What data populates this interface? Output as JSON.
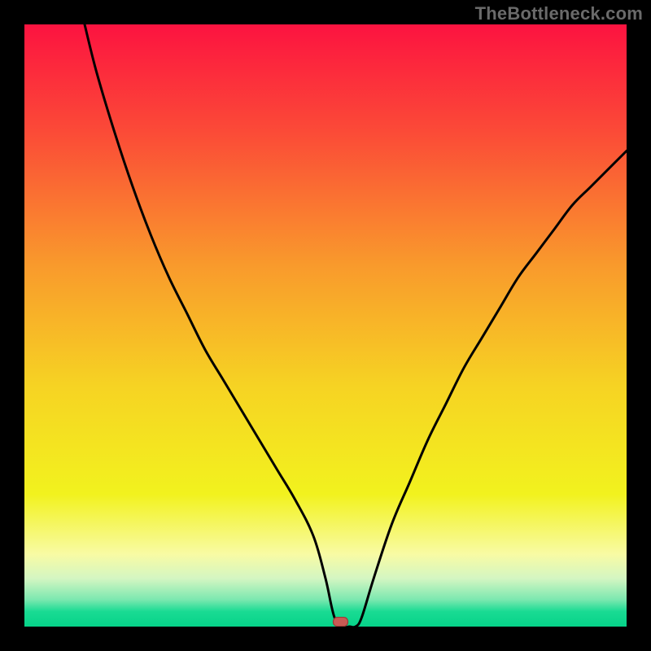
{
  "attribution": "TheBottleneck.com",
  "chart_data": {
    "type": "line",
    "title": "",
    "xlabel": "",
    "ylabel": "",
    "xlim": [
      0,
      100
    ],
    "ylim": [
      0,
      100
    ],
    "x": [
      10,
      12,
      15,
      18,
      21,
      24,
      27,
      30,
      33,
      36,
      39,
      42,
      45,
      48,
      50,
      51.5,
      53,
      54,
      55,
      56,
      58,
      61,
      64,
      67,
      70,
      73,
      76,
      79,
      82,
      85,
      88,
      91,
      94,
      97,
      100
    ],
    "values": [
      100,
      92,
      82,
      73,
      65,
      58,
      52,
      46,
      41,
      36,
      31,
      26,
      21,
      15,
      8,
      1.5,
      0,
      0,
      0,
      1.5,
      8,
      17,
      24,
      31,
      37,
      43,
      48,
      53,
      58,
      62,
      66,
      70,
      73,
      76,
      79
    ],
    "background_gradient": {
      "stops": [
        {
          "offset": 0.0,
          "color": "#fc1340"
        },
        {
          "offset": 0.18,
          "color": "#fb4b37"
        },
        {
          "offset": 0.4,
          "color": "#f99a2c"
        },
        {
          "offset": 0.6,
          "color": "#f6d323"
        },
        {
          "offset": 0.78,
          "color": "#f2f21e"
        },
        {
          "offset": 0.88,
          "color": "#f8fba4"
        },
        {
          "offset": 0.92,
          "color": "#d4f6c2"
        },
        {
          "offset": 0.955,
          "color": "#7ce8b0"
        },
        {
          "offset": 0.975,
          "color": "#19db93"
        },
        {
          "offset": 1.0,
          "color": "#06d389"
        }
      ]
    },
    "marker": {
      "x": 52.5,
      "y": 0.8,
      "color_fill": "#c85a54",
      "color_stroke": "#9c3a36"
    },
    "curve_color": "#000000",
    "curve_width": 3
  }
}
